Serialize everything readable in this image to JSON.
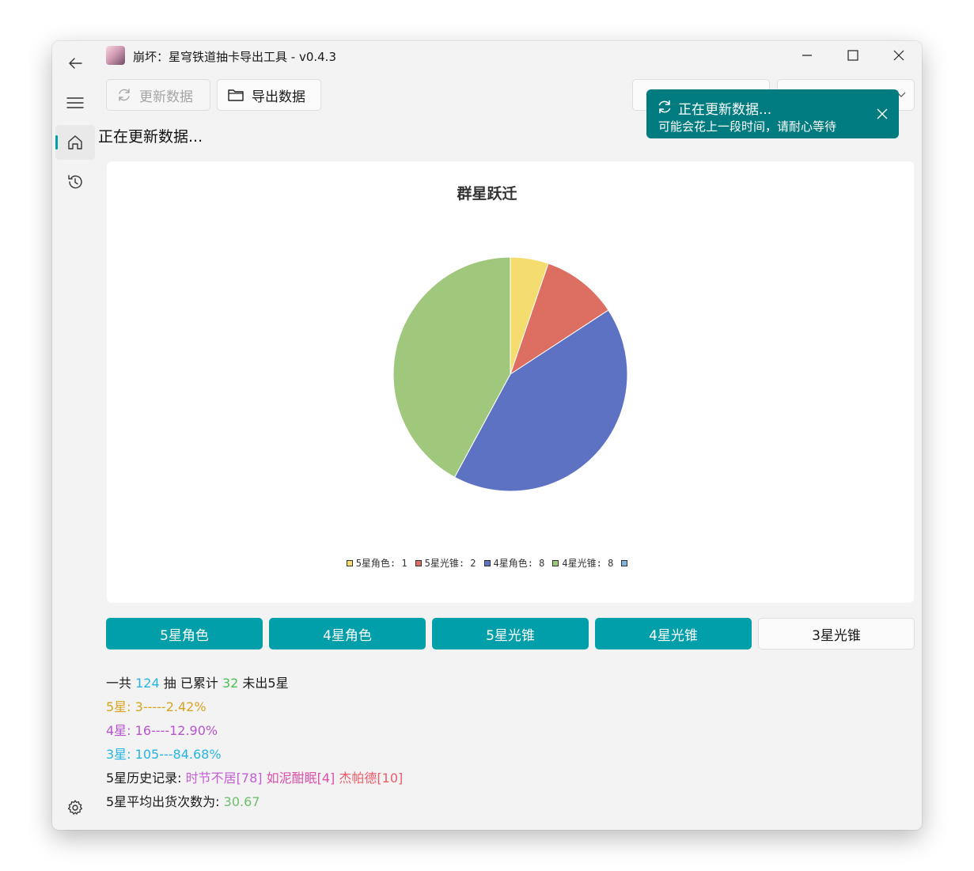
{
  "window": {
    "title": "崩坏：星穹铁道抽卡导出工具 - v0.4.3"
  },
  "nav": {
    "back_icon": "back-arrow-icon",
    "menu_icon": "hamburger-menu-icon",
    "items": [
      {
        "icon": "home-icon",
        "active": true
      },
      {
        "icon": "history-icon",
        "active": false
      }
    ],
    "settings_icon": "gear-icon"
  },
  "toolbar": {
    "update_label": "更新数据",
    "export_label": "导出数据"
  },
  "status_text": "正在更新数据...",
  "toast": {
    "title": "正在更新数据...",
    "message": "可能会花上一段时间，请耐心等待",
    "color": "#007b80"
  },
  "chart_data": {
    "type": "pie",
    "title": "群星跃迁",
    "slices": [
      {
        "name": "5星角色",
        "value": 1,
        "color": "#f5dc6e",
        "legend": "5星角色: 1"
      },
      {
        "name": "5星光锥",
        "value": 2,
        "color": "#dc6e62",
        "legend": "5星光锥: 2"
      },
      {
        "name": "4星角色",
        "value": 8,
        "color": "#5d72c2",
        "legend": "4星角色: 8"
      },
      {
        "name": "4星光锥",
        "value": 8,
        "color": "#a0c87d",
        "legend": "4星光锥: 8"
      },
      {
        "name": "",
        "value": 0,
        "color": "#7fb6de",
        "legend": ""
      }
    ],
    "legend_position": "bottom"
  },
  "tabs": [
    {
      "label": "5星角色",
      "selected": true
    },
    {
      "label": "4星角色",
      "selected": true
    },
    {
      "label": "5星光锥",
      "selected": true
    },
    {
      "label": "4星光锥",
      "selected": true
    },
    {
      "label": "3星光锥",
      "selected": false
    }
  ],
  "stats": {
    "total_prefix": "一共",
    "total_count": "124",
    "total_middle": "抽 已累计",
    "pity_count": "32",
    "pity_suffix": "未出5星",
    "five_star": "5星: 3-----2.42%",
    "four_star": "4星: 16----12.90%",
    "three_star": "3星: 105---84.68%",
    "history_label": "5星历史记录: ",
    "history": [
      {
        "text": "时节不居[78]",
        "color": "#c45fd4"
      },
      {
        "text": "如泥酣眠[4]",
        "color": "#df4fa9"
      },
      {
        "text": "杰帕德[10]",
        "color": "#ee5c6a"
      }
    ],
    "avg_label": "5星平均出货次数为: ",
    "avg_value": "30.67"
  },
  "colors": {
    "accent": "#009faa",
    "count_blue": "#25b5e5",
    "count_green": "#49bf52",
    "five_star": "#d9a21f",
    "four_star": "#b655cf",
    "three_star": "#25b5e5",
    "avg_green": "#6dbf6b"
  }
}
